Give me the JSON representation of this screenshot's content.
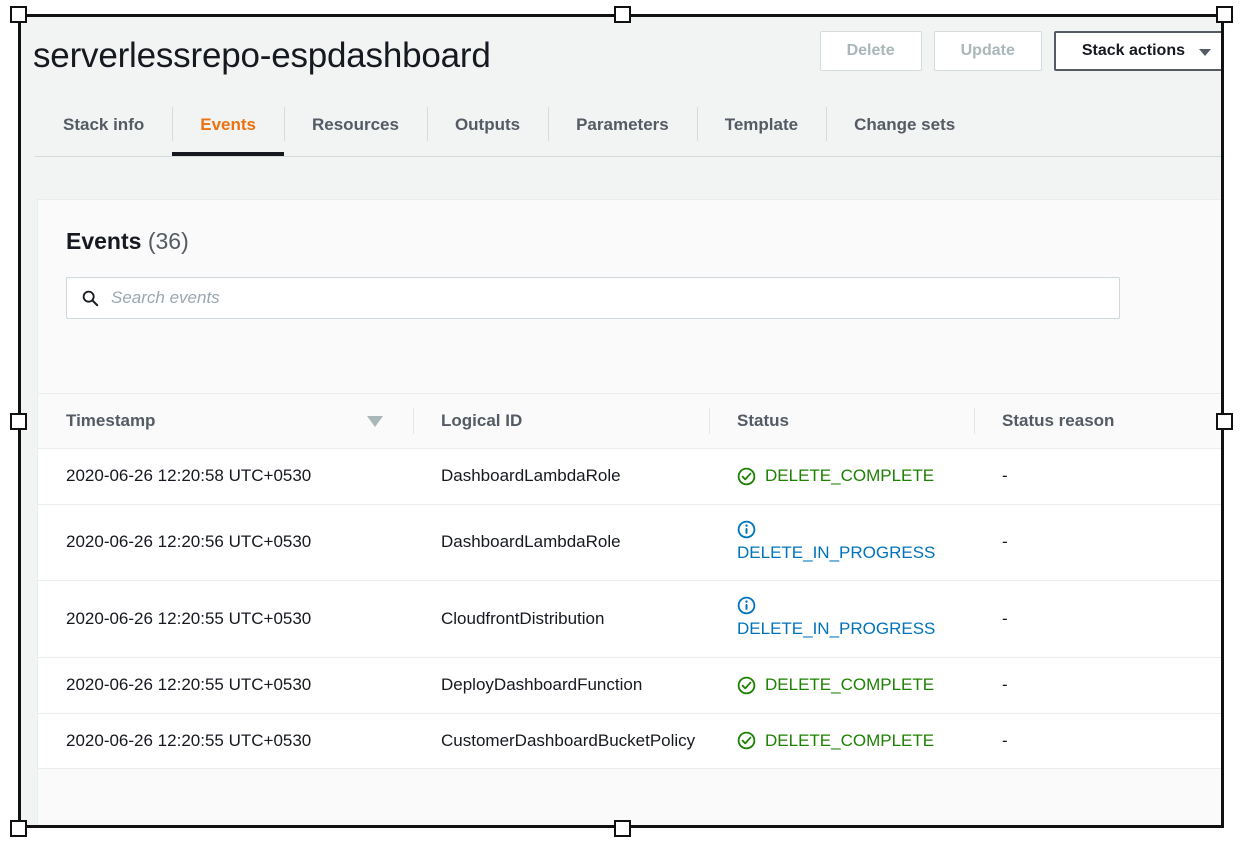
{
  "header": {
    "stack_name": "serverlessrepo-espdashboard",
    "buttons": [
      {
        "label": "Delete",
        "name": "delete-button",
        "state": "disabled"
      },
      {
        "label": "Update",
        "name": "update-button",
        "state": "disabled"
      },
      {
        "label": "Stack actions",
        "name": "stack-actions-button",
        "state": "enabled",
        "icon": "chevron-down-icon"
      }
    ]
  },
  "tabs": [
    {
      "label": "Stack info",
      "active": false
    },
    {
      "label": "Events",
      "active": true
    },
    {
      "label": "Resources",
      "active": false
    },
    {
      "label": "Outputs",
      "active": false
    },
    {
      "label": "Parameters",
      "active": false
    },
    {
      "label": "Template",
      "active": false
    },
    {
      "label": "Change sets",
      "active": false
    }
  ],
  "panel": {
    "title": "Events",
    "count": "(36)",
    "search": {
      "placeholder": "Search events",
      "value": "",
      "icon": "search-icon"
    }
  },
  "table": {
    "columns": [
      {
        "label": "Timestamp",
        "sort": "descending",
        "sort_icon": "caret-down-icon"
      },
      {
        "label": "Logical ID",
        "sort": "none"
      },
      {
        "label": "Status",
        "sort": "none"
      },
      {
        "label": "Status reason",
        "sort": "none"
      }
    ],
    "rows": [
      {
        "timestamp": "2020-06-26 12:20:58 UTC+0530",
        "logical_id": "DashboardLambdaRole",
        "status": "DELETE_COMPLETE",
        "status_kind": "complete",
        "status_icon": "check-circle-icon",
        "status_reason": "-"
      },
      {
        "timestamp": "2020-06-26 12:20:56 UTC+0530",
        "logical_id": "DashboardLambdaRole",
        "status": "DELETE_IN_PROGRESS",
        "status_kind": "progress",
        "status_icon": "info-circle-icon",
        "status_reason": "-"
      },
      {
        "timestamp": "2020-06-26 12:20:55 UTC+0530",
        "logical_id": "CloudfrontDistribution",
        "status": "DELETE_IN_PROGRESS",
        "status_kind": "progress",
        "status_icon": "info-circle-icon",
        "status_reason": "-"
      },
      {
        "timestamp": "2020-06-26 12:20:55 UTC+0530",
        "logical_id": "DeployDashboardFunction",
        "status": "DELETE_COMPLETE",
        "status_kind": "complete",
        "status_icon": "check-circle-icon",
        "status_reason": "-"
      },
      {
        "timestamp": "2020-06-26 12:20:55 UTC+0530",
        "logical_id": "CustomerDashboardBucketPolicy",
        "status": "DELETE_COMPLETE",
        "status_kind": "complete",
        "status_icon": "check-circle-icon",
        "status_reason": "-"
      }
    ]
  },
  "colors": {
    "accent_orange": "#ec7211",
    "status_complete_green": "#1d8102",
    "status_progress_blue": "#0073bb",
    "page_background": "#f2f3f3",
    "text_primary": "#16191f",
    "text_secondary": "#545b64"
  }
}
